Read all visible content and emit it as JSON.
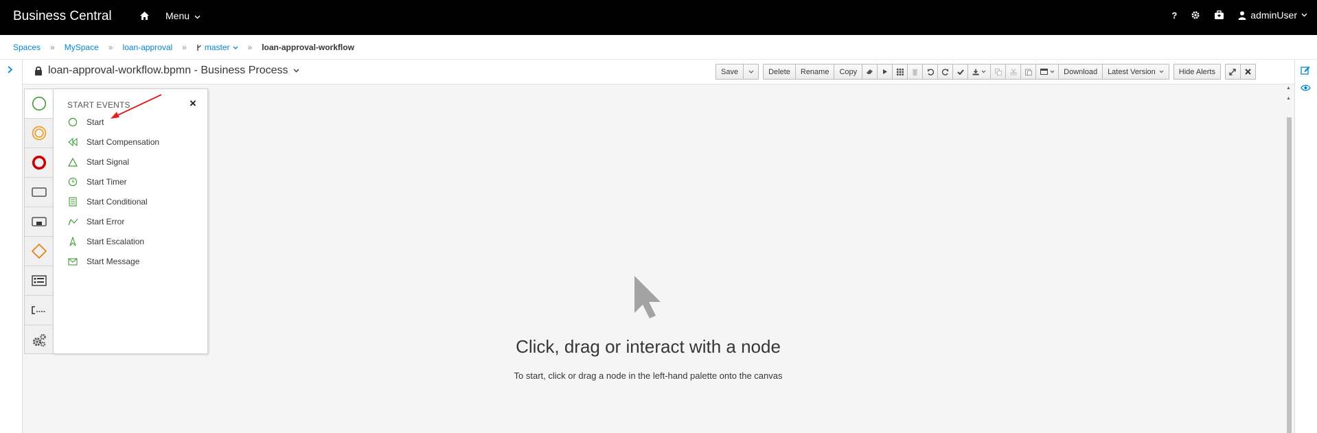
{
  "app": {
    "brand": "Business Central",
    "menu_label": "Menu",
    "help_label": "?",
    "user_name": "adminUser"
  },
  "breadcrumb": {
    "items": [
      "Spaces",
      "MySpace",
      "loan-approval",
      "master"
    ],
    "current": "loan-approval-workflow",
    "separator": "»"
  },
  "editor": {
    "title": "loan-approval-workflow.bpmn - Business Process",
    "toolbar": {
      "save": "Save",
      "delete": "Delete",
      "rename": "Rename",
      "copy": "Copy",
      "download": "Download",
      "latest_version": "Latest Version",
      "hide_alerts": "Hide Alerts"
    }
  },
  "palette": {
    "categories": [
      "start-events",
      "intermediate-events",
      "end-events",
      "tasks",
      "subprocesses",
      "gateways",
      "containers",
      "artifacts",
      "custom-tasks"
    ],
    "flyout": {
      "heading": "START EVENTS",
      "close": "×",
      "items": [
        "Start",
        "Start Compensation",
        "Start Signal",
        "Start Timer",
        "Start Conditional",
        "Start Error",
        "Start Escalation",
        "Start Message"
      ]
    }
  },
  "canvas": {
    "empty_title": "Click, drag or interact with a node",
    "empty_subtitle": "To start, click or drag a node in the left-hand palette onto the canvas"
  },
  "colors": {
    "topbar": "#000000",
    "link": "#0088ce",
    "start_green": "#3f9c35",
    "intermediate_orange": "#ec7a08",
    "end_red": "#cc0000",
    "annotation_red": "#e0201b"
  }
}
